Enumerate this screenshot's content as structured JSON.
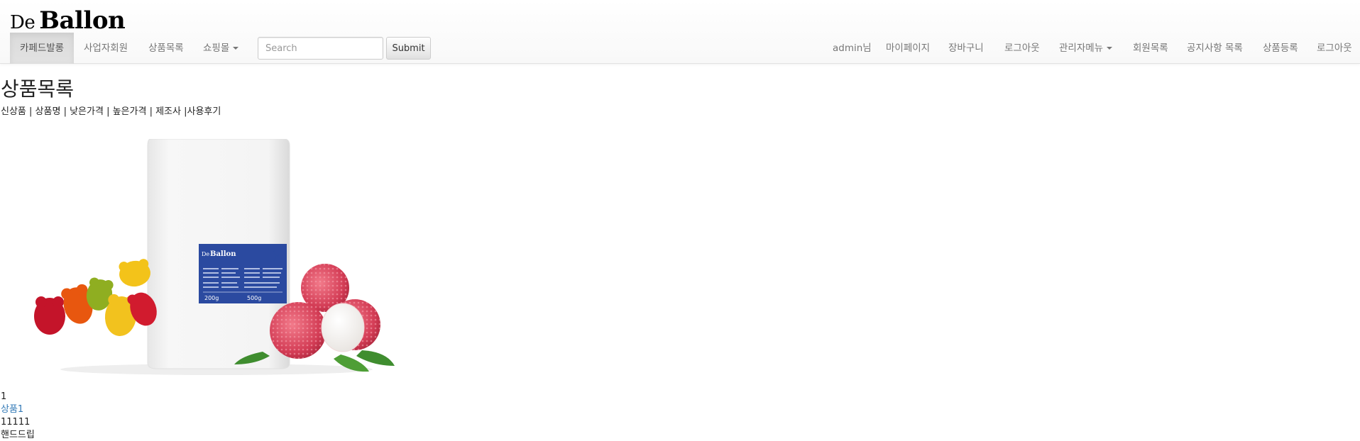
{
  "brand": {
    "prefix": "De",
    "name": "Ballon"
  },
  "nav_left": {
    "items": [
      "카페드발롱",
      "사업자회원",
      "상품목록"
    ],
    "dropdown": "쇼핑몰"
  },
  "search": {
    "placeholder": "Search",
    "submit_label": "Submit"
  },
  "nav_right": {
    "greeting": "admin님",
    "mypage": "마이페이지",
    "cart": "장바구니",
    "logout": "로그아웃",
    "admin_menu": "관리자메뉴",
    "members": "회원목록",
    "notices": "공지사항 목록",
    "add_product": "상품등록",
    "logout_2": "로그아웃"
  },
  "main": {
    "title": "상품목록",
    "sort_options": [
      "신상품",
      "상품명",
      "낮은가격",
      "높은가격",
      "제조사",
      "사용후기"
    ],
    "sort_separator": " | "
  },
  "product": {
    "number": "1",
    "name": "상품1",
    "price": "11111",
    "category": "핸드드립",
    "package_brand_prefix": "De",
    "package_brand": "Ballon",
    "package_weight_a": "200g",
    "package_weight_b": "500g"
  },
  "colors": {
    "link": "#337ab7",
    "label_blue": "#2b4aa0",
    "active_tab": "#e2e2e2"
  }
}
